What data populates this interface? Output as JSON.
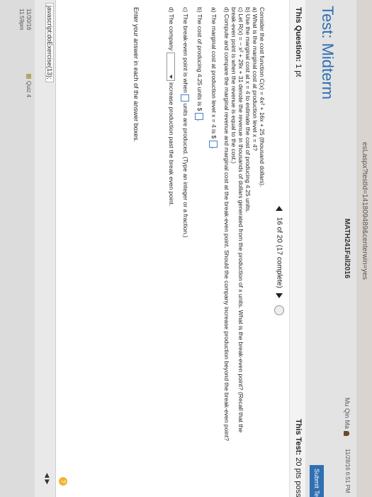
{
  "browser": {
    "url_fragment": "esLaspx?testId=141809489&centerwin=yes"
  },
  "header": {
    "course": "MATH241Fall2016",
    "user": "Mu Qin Ma",
    "datetime": "11/28/16 6:51 PM",
    "test_title": "Test: Midterm",
    "submit_label": "Submit Te"
  },
  "subbar": {
    "this_question_label": "This Question:",
    "this_question_value": "1 pt",
    "this_test_label": "This Test:",
    "this_test_value": "20 pts possi"
  },
  "nav": {
    "progress": "16 of 20 (17 complete)"
  },
  "question": {
    "intro": "Consider the cost function C(x) = 4x² + 16x + 25 (thousand dollars).",
    "part_a": "a) What is the marginal cost at production level x = 4?",
    "part_b": "b) Use the marginal cost at x = 4 to estimate the cost of producing 4.25 units.",
    "part_c": "c) Let R(x) = − x² + 29x + 31 denote the revenue in thousands of dollars generated from the production of x units. What is the break-even point? (Recall that the",
    "part_c2": "break-even point is when the revenue is equal to the cost.)",
    "part_d": "d) Compute and compare the marginal revenue and marginal cost at the break-even point. Should the company increase production beyond the break-even point?",
    "ans_a_prefix": "a) The marginal cost at production level x = 4 is $",
    "ans_a_suffix": ".",
    "ans_b_prefix": "b) The cost of producing 4.25 units is $",
    "ans_b_suffix": ".",
    "ans_c_prefix": "c) The break-even point is when",
    "ans_c_suffix": "units are produced. (Type an integer or a fraction.)",
    "ans_d_prefix": "d) The company",
    "ans_d_suffix": "increase production past the break even point.",
    "instruction": "Enter your answer in each of the answer boxes."
  },
  "statusbar": {
    "js_url": "javascript:doExercise(13);",
    "task1_line1": "11/30/16",
    "task1_line2": "11:59pm",
    "task2": "Quiz 4",
    "help": "?"
  }
}
